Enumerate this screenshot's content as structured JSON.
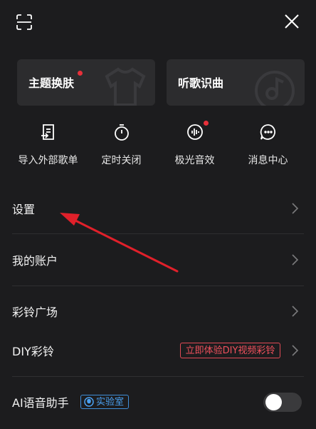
{
  "cards": [
    {
      "label": "主题换肤",
      "has_dot": true,
      "deco_icon": "tshirt-icon"
    },
    {
      "label": "听歌识曲",
      "has_dot": false,
      "deco_icon": "music-note-icon"
    }
  ],
  "quick_actions": [
    {
      "label": "导入外部歌单",
      "icon": "import-playlist-icon"
    },
    {
      "label": "定时关闭",
      "icon": "timer-icon"
    },
    {
      "label": "极光音效",
      "icon": "sound-effect-icon",
      "has_dot": true
    },
    {
      "label": "消息中心",
      "icon": "message-icon"
    }
  ],
  "menu": {
    "settings": "设置",
    "my_account": "我的账户",
    "ringtone_square": "彩铃广场",
    "diy_ringtone": "DIY彩铃",
    "diy_promo": "立即体验DIY视频彩铃",
    "ai_assistant": "AI语音助手",
    "lab_badge": "实验室"
  },
  "toggle_state": "off",
  "colors": {
    "background": "#1c1c1e",
    "card": "#2c2c2e",
    "accent_red": "#e8303a",
    "badge_blue": "#3f8ed8",
    "annotation_arrow": "#e0202a"
  }
}
